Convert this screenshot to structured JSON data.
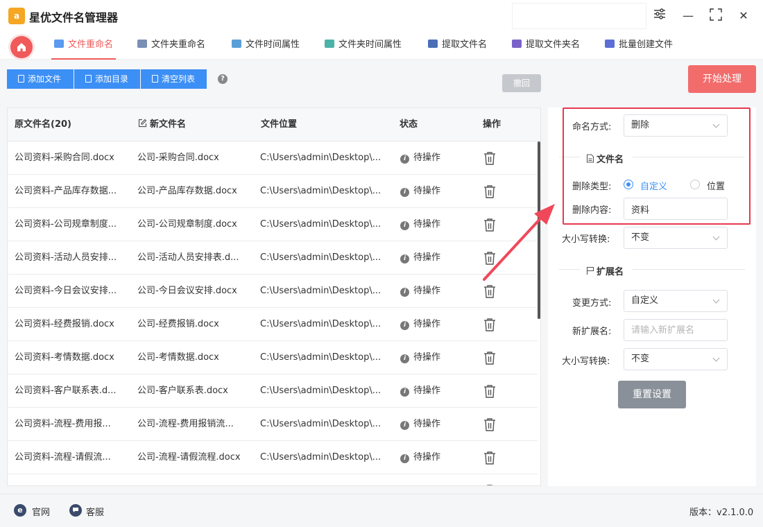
{
  "app": {
    "title": "星优文件名管理器",
    "logo_text": "a"
  },
  "window": {
    "settings_icon": "sliders-icon",
    "minimize": "—",
    "maximize": "⛶",
    "close": "✕"
  },
  "tabs": [
    {
      "label": "文件重命名",
      "active": true,
      "icon_color": "#5a9bf0"
    },
    {
      "label": "文件夹重命名",
      "active": false,
      "icon_color": "#7a8fb5"
    },
    {
      "label": "文件时间属性",
      "active": false,
      "icon_color": "#5aa0d8"
    },
    {
      "label": "文件夹时间属性",
      "active": false,
      "icon_color": "#4cb3a8"
    },
    {
      "label": "提取文件名",
      "active": false,
      "icon_color": "#4a6fb5"
    },
    {
      "label": "提取文件夹名",
      "active": false,
      "icon_color": "#7a62c9"
    },
    {
      "label": "批量创建文件",
      "active": false,
      "icon_color": "#5b6fd6"
    }
  ],
  "toolbar": {
    "add_file": "添加文件",
    "add_dir": "添加目录",
    "clear_list": "清空列表",
    "help": "?",
    "undo": "撤回",
    "start": "开始处理"
  },
  "table": {
    "headers": {
      "original": "原文件名(20)",
      "new": "新文件名",
      "location": "文件位置",
      "status": "状态",
      "action": "操作"
    },
    "rows": [
      {
        "original": "公司资料-采购合同.docx",
        "new": "公司-采购合同.docx",
        "location": "C:\\Users\\admin\\Desktop\\...",
        "status": "待操作"
      },
      {
        "original": "公司资料-产品库存数据...",
        "new": "公司-产品库存数据.docx",
        "location": "C:\\Users\\admin\\Desktop\\...",
        "status": "待操作"
      },
      {
        "original": "公司资料-公司规章制度...",
        "new": "公司-公司规章制度.docx",
        "location": "C:\\Users\\admin\\Desktop\\...",
        "status": "待操作"
      },
      {
        "original": "公司资料-活动人员安排...",
        "new": "公司-活动人员安排表.d...",
        "location": "C:\\Users\\admin\\Desktop\\...",
        "status": "待操作"
      },
      {
        "original": "公司资料-今日会议安排...",
        "new": "公司-今日会议安排.docx",
        "location": "C:\\Users\\admin\\Desktop\\...",
        "status": "待操作"
      },
      {
        "original": "公司资料-经费报销.docx",
        "new": "公司-经费报销.docx",
        "location": "C:\\Users\\admin\\Desktop\\...",
        "status": "待操作"
      },
      {
        "original": "公司资料-考情数据.docx",
        "new": "公司-考情数据.docx",
        "location": "C:\\Users\\admin\\Desktop\\...",
        "status": "待操作"
      },
      {
        "original": "公司资料-客户联系表.d...",
        "new": "公司-客户联系表.docx",
        "location": "C:\\Users\\admin\\Desktop\\...",
        "status": "待操作"
      },
      {
        "original": "公司资料-流程-费用报...",
        "new": "公司-流程-费用报销流...",
        "location": "C:\\Users\\admin\\Desktop\\...",
        "status": "待操作"
      },
      {
        "original": "公司资料-流程-请假流...",
        "new": "公司-流程-请假流程.docx",
        "location": "C:\\Users\\admin\\Desktop\\...",
        "status": "待操作"
      }
    ]
  },
  "panel": {
    "naming_label": "命名方式:",
    "naming_value": "删除",
    "filename_section": "文件名",
    "delete_type_label": "删除类型:",
    "delete_type_options": [
      "自定义",
      "位置"
    ],
    "delete_type_selected": "自定义",
    "delete_content_label": "删除内容:",
    "delete_content_value": "资料",
    "case_label": "大小写转换:",
    "case_value": "不变",
    "ext_section": "扩展名",
    "change_mode_label": "变更方式:",
    "change_mode_value": "自定义",
    "new_ext_label": "新扩展名:",
    "new_ext_placeholder": "请输入新扩展名",
    "ext_case_label": "大小写转换:",
    "ext_case_value": "不变",
    "reset": "重置设置"
  },
  "footer": {
    "website": "官网",
    "support": "客服",
    "version": "版本：v2.1.0.0"
  },
  "colors": {
    "accent_red": "#f05a5a",
    "primary_blue": "#3c8ff5",
    "highlight_box": "#e8384f"
  }
}
